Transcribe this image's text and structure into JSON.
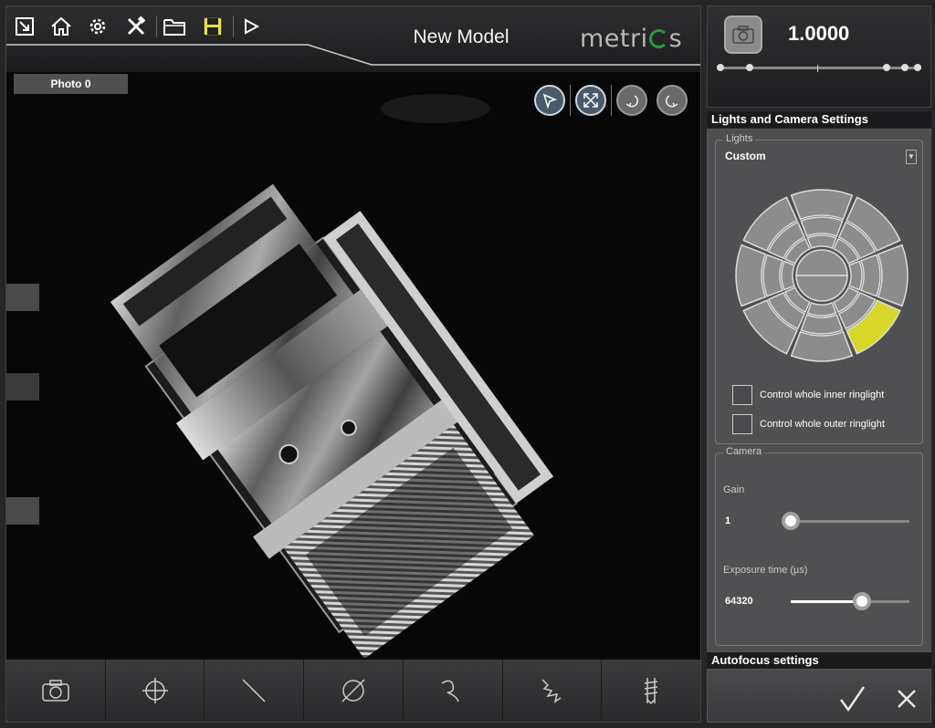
{
  "header": {
    "model_title": "New Model",
    "logo_text_a": "metri",
    "logo_text_b": "s",
    "toolbar_icons": [
      "fullscreen-icon",
      "home-icon",
      "gear-icon",
      "tools-icon",
      "folder-icon",
      "save-icon",
      "play-icon"
    ]
  },
  "viewer": {
    "photo_tab": "Photo 0",
    "buttons": [
      "pointer-icon",
      "fit-view-icon",
      "undo-icon",
      "redo-icon"
    ]
  },
  "bottom_toolbar": [
    "camera-icon",
    "crosshair-icon",
    "line-icon",
    "diameter-icon",
    "curve-icon",
    "zigzag-icon",
    "thread-icon"
  ],
  "zoom": {
    "value": "1.0000"
  },
  "lights_camera": {
    "section_title": "Lights and Camera Settings",
    "lights_group_title": "Lights",
    "lights_mode": "Custom",
    "active_ring_segment": "outer-lower-right",
    "active_segment_color": "#d9d62a",
    "checkbox_inner": "Control whole inner ringlight",
    "checkbox_outer": "Control whole outer ringlight",
    "camera_group_title": "Camera",
    "gain_label": "Gain",
    "gain_value": "1",
    "gain_fraction": 0.0,
    "exposure_label": "Exposure time (µs)",
    "exposure_value": "64320",
    "exposure_fraction": 0.6
  },
  "autofocus": {
    "section_title": "Autofocus settings"
  },
  "footer": {
    "confirm_icon": "check-icon",
    "cancel_icon": "close-icon"
  },
  "colors": {
    "accent_green": "#2a9a3e",
    "highlight_yellow": "#d9d62a"
  }
}
